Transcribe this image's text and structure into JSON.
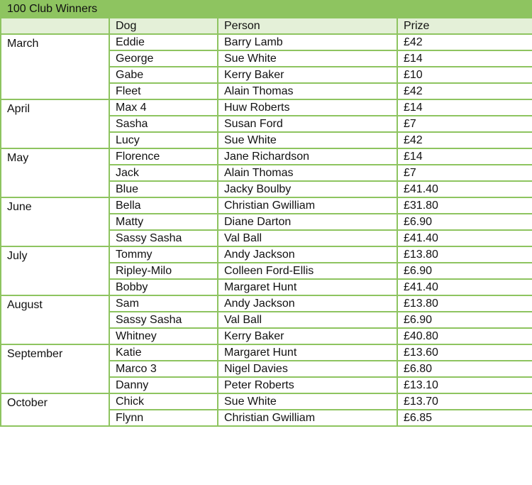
{
  "title": "100 Club Winners",
  "colors": {
    "border": "#8ec460",
    "title_bg": "#8ec460",
    "header_bg": "#e4f0d8"
  },
  "headers": {
    "dog": "Dog",
    "person": "Person",
    "prize": "Prize"
  },
  "months": [
    {
      "month": "March",
      "rows": [
        {
          "dog": "Eddie",
          "person": "Barry Lamb",
          "prize": "£42"
        },
        {
          "dog": "George",
          "person": "Sue White",
          "prize": "£14"
        },
        {
          "dog": "Gabe",
          "person": "Kerry Baker",
          "prize": "£10"
        },
        {
          "dog": "Fleet",
          "person": "Alain Thomas",
          "prize": "£42"
        }
      ]
    },
    {
      "month": "April",
      "rows": [
        {
          "dog": "Max 4",
          "person": "Huw Roberts",
          "prize": "£14"
        },
        {
          "dog": "Sasha",
          "person": "Susan Ford",
          "prize": "£7"
        },
        {
          "dog": "Lucy",
          "person": "Sue White",
          "prize": "£42"
        }
      ]
    },
    {
      "month": "May",
      "rows": [
        {
          "dog": "Florence",
          "person": "Jane Richardson",
          "prize": "£14"
        },
        {
          "dog": "Jack",
          "person": "Alain Thomas",
          "prize": "£7"
        },
        {
          "dog": "Blue",
          "person": "Jacky Boulby",
          "prize": "£41.40"
        }
      ]
    },
    {
      "month": "June",
      "rows": [
        {
          "dog": "Bella",
          "person": "Christian Gwilliam",
          "prize": "£31.80"
        },
        {
          "dog": "Matty",
          "person": "Diane Darton",
          "prize": "£6.90"
        },
        {
          "dog": "Sassy Sasha",
          "person": "Val Ball",
          "prize": "£41.40"
        }
      ]
    },
    {
      "month": "July",
      "rows": [
        {
          "dog": "Tommy",
          "person": "Andy Jackson",
          "prize": "£13.80"
        },
        {
          "dog": "Ripley-Milo",
          "person": "Colleen Ford-Ellis",
          "prize": "£6.90"
        },
        {
          "dog": "Bobby",
          "person": "Margaret Hunt",
          "prize": "£41.40"
        }
      ]
    },
    {
      "month": "August",
      "rows": [
        {
          "dog": "Sam",
          "person": "Andy Jackson",
          "prize": "£13.80"
        },
        {
          "dog": "Sassy Sasha",
          "person": "Val Ball",
          "prize": "£6.90"
        },
        {
          "dog": "Whitney",
          "person": "Kerry Baker",
          "prize": "£40.80"
        }
      ]
    },
    {
      "month": "September",
      "rows": [
        {
          "dog": "Katie",
          "person": "Margaret Hunt",
          "prize": "£13.60"
        },
        {
          "dog": "Marco 3",
          "person": "Nigel Davies",
          "prize": "£6.80"
        },
        {
          "dog": "Danny",
          "person": "Peter Roberts",
          "prize": "£13.10"
        }
      ]
    },
    {
      "month": "October",
      "rows": [
        {
          "dog": "Chick",
          "person": "Sue White",
          "prize": "£13.70"
        },
        {
          "dog": "Flynn",
          "person": "Christian Gwilliam",
          "prize": "£6.85"
        }
      ]
    }
  ]
}
